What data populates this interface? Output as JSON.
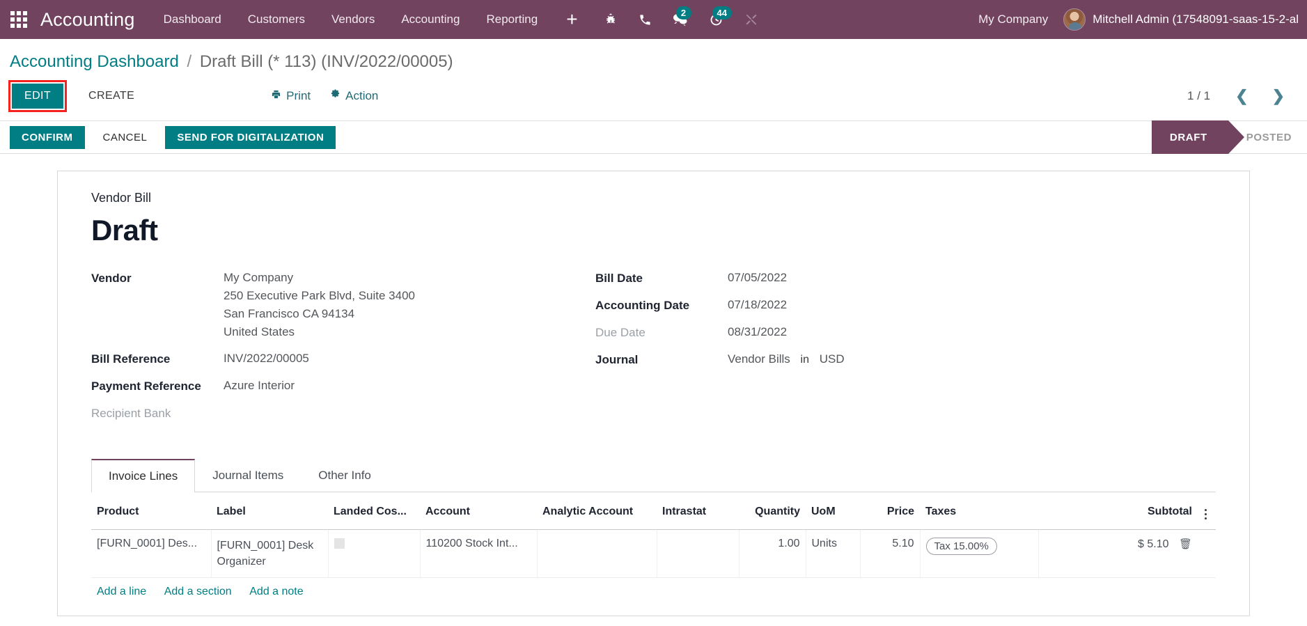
{
  "navbar": {
    "apps_icon": "apps-grid-icon",
    "brand": "Accounting",
    "menu": [
      "Dashboard",
      "Customers",
      "Vendors",
      "Accounting",
      "Reporting"
    ],
    "plus_label": "+",
    "icons": [
      {
        "name": "bug-icon",
        "badge": null
      },
      {
        "name": "phone-icon",
        "badge": null
      },
      {
        "name": "messages-icon",
        "badge": "2"
      },
      {
        "name": "activities-clock-icon",
        "badge": "44"
      },
      {
        "name": "tools-icon",
        "badge": null
      }
    ],
    "company": "My Company",
    "user": "Mitchell Admin (17548091-saas-15-2-al",
    "bg_color": "#71435f",
    "badge_color": "#017e84"
  },
  "breadcrumb": {
    "root": "Accounting Dashboard",
    "separator": "/",
    "current": "Draft Bill (* 113) (INV/2022/00005)"
  },
  "control_panel": {
    "edit_label": "EDIT",
    "create_label": "CREATE",
    "print_label": "Print",
    "action_label": "Action",
    "pager_count": "1 / 1",
    "prev_icon": "chevron-left-icon",
    "next_icon": "chevron-right-icon",
    "highlight_color": "#f5231f"
  },
  "statusbar": {
    "confirm_label": "CONFIRM",
    "cancel_label": "CANCEL",
    "digitalization_label": "SEND FOR DIGITALIZATION",
    "stages": [
      {
        "label": "DRAFT",
        "active": true
      },
      {
        "label": "POSTED",
        "active": false
      }
    ],
    "active_color": "#71435f"
  },
  "form": {
    "doc_type": "Vendor Bill",
    "doc_title": "Draft",
    "left_fields": [
      {
        "label": "Vendor",
        "value": "My Company",
        "is_link": true,
        "extra": [
          "250 Executive Park Blvd, Suite 3400",
          "San Francisco CA 94134",
          "United States"
        ]
      },
      {
        "label": "Bill Reference",
        "value": "INV/2022/00005",
        "is_link": false,
        "extra": []
      },
      {
        "label": "Payment Reference",
        "value": "Azure Interior",
        "is_link": false,
        "extra": []
      },
      {
        "label": "Recipient Bank",
        "value": "",
        "is_link": false,
        "muted": true,
        "extra": []
      }
    ],
    "right_fields": [
      {
        "label": "Bill Date",
        "value": "07/05/2022",
        "muted_label": false
      },
      {
        "label": "Accounting Date",
        "value": "07/18/2022",
        "muted_label": false
      },
      {
        "label": "Due Date",
        "value": "08/31/2022",
        "muted_label": true
      }
    ],
    "journal": {
      "label": "Journal",
      "value": "Vendor Bills",
      "in_word": "in",
      "currency": "USD"
    }
  },
  "notebook": {
    "tabs": [
      {
        "label": "Invoice Lines",
        "active": true
      },
      {
        "label": "Journal Items",
        "active": false
      },
      {
        "label": "Other Info",
        "active": false
      }
    ]
  },
  "lines_table": {
    "columns": [
      "Product",
      "Label",
      "Landed Cos...",
      "Account",
      "Analytic Account",
      "Intrastat",
      "Quantity",
      "UoM",
      "Price",
      "Taxes",
      "Subtotal"
    ],
    "options_icon": "vertical-dots-icon",
    "rows": [
      {
        "product": "[FURN_0001] Des...",
        "label": "[FURN_0001] Desk Organizer",
        "landed_cost": "",
        "account": "110200 Stock Int...",
        "analytic_account": "",
        "intrastat": "",
        "quantity": "1.00",
        "uom": "Units",
        "price": "5.10",
        "taxes": "Tax 15.00%",
        "subtotal": "$ 5.10",
        "delete_icon": "trash-icon"
      }
    ],
    "add_links": [
      "Add a line",
      "Add a section",
      "Add a note"
    ]
  }
}
